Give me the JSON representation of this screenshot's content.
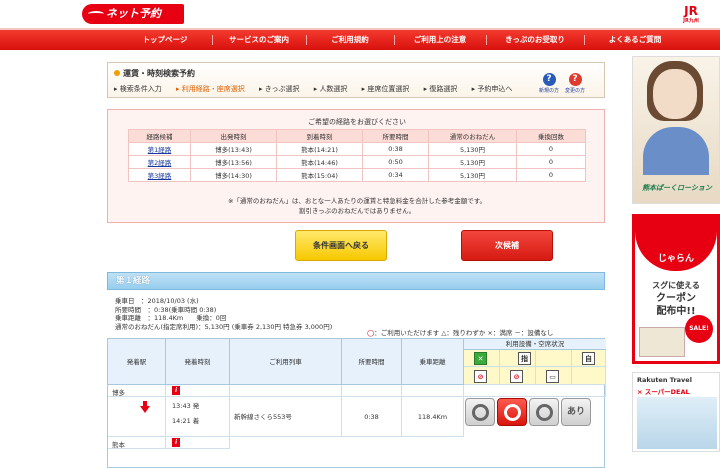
{
  "header": {
    "logo_text": "ネット予約",
    "jr_text": "JR",
    "jr_sub": "JR九州"
  },
  "nav": [
    "トップページ",
    "サービスのご案内",
    "ご利用規約",
    "ご利用上の注意",
    "きっぷのお受取り",
    "よくあるご質問"
  ],
  "steps": {
    "title": "運賃・時刻検索予約",
    "items": [
      "検索条件入力",
      "利用経路・座席選択",
      "きっぷ選択",
      "人数選択",
      "座席位置選択",
      "復路選択",
      "予約申込へ"
    ],
    "current_index": 1,
    "help1": "新規の方",
    "help2": "変更の方"
  },
  "routes": {
    "heading": "ご希望の経路をお選びください",
    "headers": [
      "経路候補",
      "出発時刻",
      "到着時刻",
      "所要時間",
      "通常のおねだん",
      "乗換回数"
    ],
    "rows": [
      [
        "第1経路",
        "博多(13:43)",
        "熊本(14:21)",
        "0:38",
        "5,130円",
        "0"
      ],
      [
        "第2経路",
        "博多(13:56)",
        "熊本(14:46)",
        "0:50",
        "5,130円",
        "0"
      ],
      [
        "第3経路",
        "博多(14:30)",
        "熊本(15:04)",
        "0:34",
        "5,130円",
        "0"
      ]
    ],
    "note1": "※「通常のおねだん」は、おとな一人あたりの運賃と特急料金を合計した参考金額です。",
    "note2": "割引きっぷのおねだんではありません。"
  },
  "buttons": {
    "back": "条件画面へ戻る",
    "next": "次候補"
  },
  "section": {
    "title": "第１経路"
  },
  "info": {
    "date": "乗車日　：2018/10/03 (水)",
    "duration": "所要時間　：0:38(乗車時間 0:38)",
    "distance": "乗車距離　：118.4Km　　乗換：0回",
    "price": "通常のおねだん(指定席利用)：5,130円 (乗車券 2,130円  特急券 3,000円)",
    "legend_circle": "◯",
    "legend_text": "：ご利用いただけます  △：残りわずか  ×：満席  －：設備なし"
  },
  "detail": {
    "headers": [
      "発着駅",
      "発着時刻",
      "ご利用列車",
      "所要時間",
      "乗車距離"
    ],
    "facility_head": "利用設備・空席状況",
    "fac_icons": [
      "指",
      "自"
    ],
    "dep_station": "博多",
    "arr_station": "熊本",
    "dep_time": "13:43 発",
    "arr_time": "14:21 着",
    "train": "新幹線さくら553号",
    "time": "0:38",
    "dist": "118.4Km",
    "seat_last": "あり"
  },
  "ads": {
    "ad1_text": "熊本ぱーくローション",
    "ad2_top": "じゃらん",
    "ad2_line1": "スグに使える",
    "ad2_line2": "クーポン",
    "ad2_line3": "配布中!!",
    "ad2_sale": "SALE!",
    "ad3_line1": "Rakuten Travel",
    "ad3_line2": "× スーパーDEAL"
  },
  "colors": {
    "brand_red": "#e60012",
    "nav_red": "#e8251c",
    "section_blue": "#96cdee"
  }
}
